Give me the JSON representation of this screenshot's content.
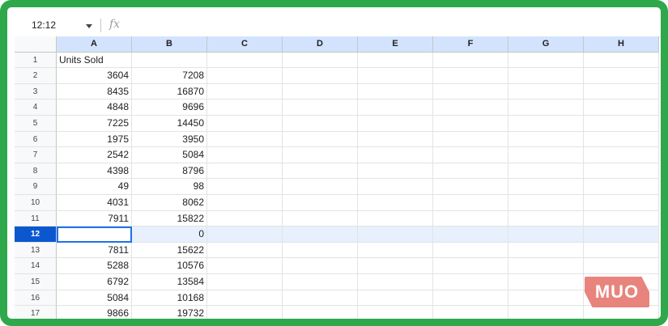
{
  "formula_bar": {
    "name_box": "12:12",
    "fx_label": "fx"
  },
  "columns": [
    "A",
    "B",
    "C",
    "D",
    "E",
    "F",
    "G",
    "H"
  ],
  "rows": [
    {
      "num": "1",
      "a": "Units Sold",
      "b": ""
    },
    {
      "num": "2",
      "a": "3604",
      "b": "7208"
    },
    {
      "num": "3",
      "a": "8435",
      "b": "16870"
    },
    {
      "num": "4",
      "a": "4848",
      "b": "9696"
    },
    {
      "num": "5",
      "a": "7225",
      "b": "14450"
    },
    {
      "num": "6",
      "a": "1975",
      "b": "3950"
    },
    {
      "num": "7",
      "a": "2542",
      "b": "5084"
    },
    {
      "num": "8",
      "a": "4398",
      "b": "8796"
    },
    {
      "num": "9",
      "a": "49",
      "b": "98"
    },
    {
      "num": "10",
      "a": "4031",
      "b": "8062"
    },
    {
      "num": "11",
      "a": "7911",
      "b": "15822"
    },
    {
      "num": "12",
      "a": "",
      "b": "0"
    },
    {
      "num": "13",
      "a": "7811",
      "b": "15622"
    },
    {
      "num": "14",
      "a": "5288",
      "b": "10576"
    },
    {
      "num": "15",
      "a": "6792",
      "b": "13584"
    },
    {
      "num": "16",
      "a": "5084",
      "b": "10168"
    },
    {
      "num": "17",
      "a": "9866",
      "b": "19732"
    }
  ],
  "selected_row": "12",
  "watermark": "MUO",
  "colors": {
    "frame": "#2ea84a",
    "header_selected": "#d3e3fd",
    "row_active": "#0b57d0",
    "selection_fill": "#e8f0fe"
  }
}
